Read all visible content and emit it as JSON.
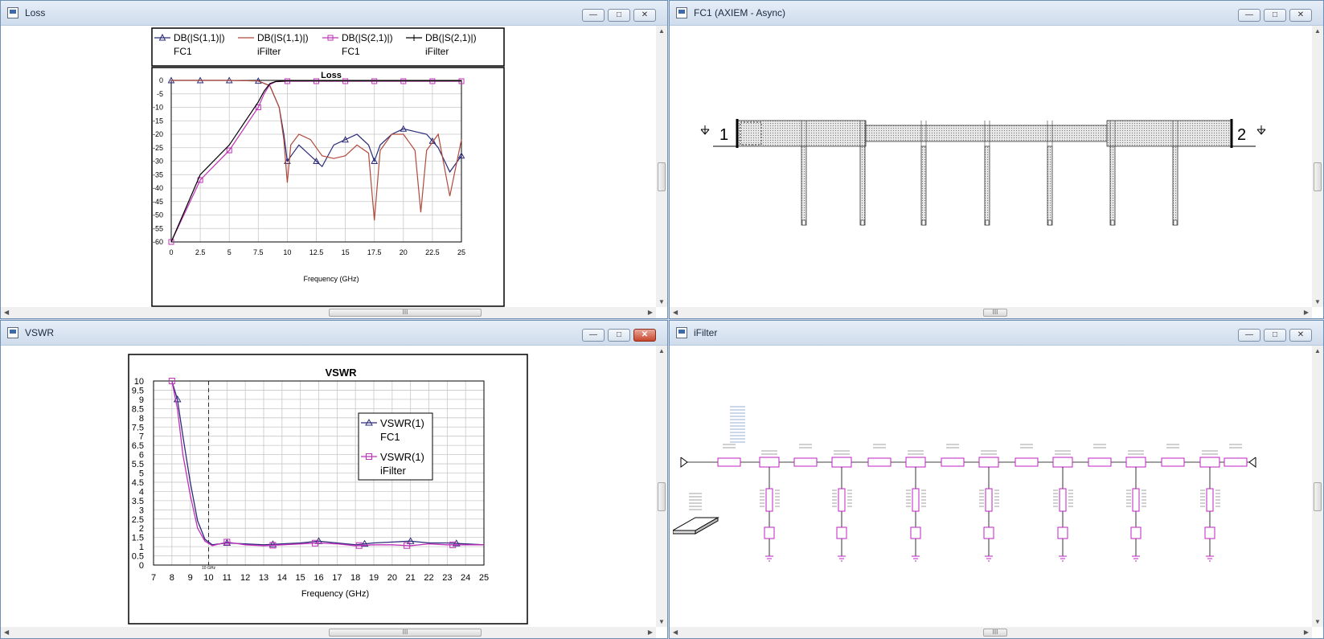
{
  "windows": {
    "loss": {
      "title": "Loss"
    },
    "fc1": {
      "title": "FC1 (AXIEM - Async)"
    },
    "vswr": {
      "title": "VSWR"
    },
    "ifilter": {
      "title": "iFilter"
    }
  },
  "scroll_thumb_label": "III",
  "fc1_layout": {
    "port1": "1",
    "port2": "2"
  },
  "colors": {
    "fc1_trace": "#2b2b7a",
    "ifilter_s11": "#b04a3a",
    "ifilter_s21": "#c030b8",
    "black": "#000000"
  },
  "chart_data": [
    {
      "type": "line",
      "title": "Loss",
      "xlabel": "Frequency (GHz)",
      "ylabel": "",
      "xlim": [
        0,
        25
      ],
      "ylim": [
        -60,
        0
      ],
      "xticks": [
        "0",
        "2.5",
        "5",
        "7.5",
        "10",
        "12.5",
        "15",
        "17.5",
        "20",
        "22.5",
        "25"
      ],
      "yticks": [
        "0",
        "-5",
        "-10",
        "-15",
        "-20",
        "-25",
        "-30",
        "-35",
        "-40",
        "-45",
        "-50",
        "-55",
        "-60"
      ],
      "grid": true,
      "legend": [
        {
          "line1": "DB(|S(1,1)|)",
          "line2": "FC1"
        },
        {
          "line1": "DB(|S(1,1)|)",
          "line2": "iFilter"
        },
        {
          "line1": "DB(|S(2,1)|)",
          "line2": "FC1"
        },
        {
          "line1": "DB(|S(2,1)|)",
          "line2": "iFilter"
        }
      ],
      "series": [
        {
          "x": [
            0,
            2.5,
            5,
            7.5,
            8.5,
            9.3,
            9.7,
            10,
            10.5,
            11,
            12,
            13,
            14,
            15,
            16,
            17,
            17.5,
            18,
            19,
            20,
            21,
            22,
            23,
            24,
            25
          ],
          "values": [
            0,
            0,
            0,
            -0.2,
            -2,
            -10,
            -20,
            -30,
            -27,
            -24,
            -28,
            -32,
            -24,
            -22,
            -20,
            -24,
            -30,
            -24,
            -20,
            -18,
            -19,
            -20,
            -25,
            -34,
            -28
          ]
        },
        {
          "x": [
            0,
            2.5,
            5,
            7.5,
            8.5,
            9.3,
            9.7,
            10,
            10.3,
            11,
            12,
            13,
            14,
            15,
            16,
            17,
            17.5,
            18,
            19,
            20,
            21,
            21.5,
            22,
            23,
            24,
            25
          ],
          "values": [
            0,
            0,
            0,
            -0.2,
            -2,
            -10,
            -22,
            -38,
            -24,
            -20,
            -22,
            -28,
            -29,
            -28,
            -24,
            -27,
            -52,
            -26,
            -20,
            -20,
            -26,
            -49,
            -26,
            -20,
            -43,
            -22
          ]
        },
        {
          "x": [
            0,
            2.5,
            5,
            7.5,
            8,
            8.5,
            9,
            10,
            12.5,
            15,
            17.5,
            20,
            22.5,
            25
          ],
          "values": [
            -60,
            -37,
            -26,
            -10,
            -5,
            -1.5,
            -0.5,
            -0.3,
            -0.3,
            -0.3,
            -0.3,
            -0.3,
            -0.3,
            -0.3
          ]
        },
        {
          "x": [
            0,
            2.5,
            5,
            7.5,
            8,
            8.5,
            9,
            10,
            12.5,
            15,
            17.5,
            20,
            22.5,
            25
          ],
          "values": [
            -60,
            -35,
            -24,
            -8,
            -4,
            -1.2,
            -0.4,
            -0.2,
            -0.2,
            -0.2,
            -0.2,
            -0.2,
            -0.2,
            -0.2
          ]
        }
      ]
    },
    {
      "type": "line",
      "title": "VSWR",
      "xlabel": "Frequency (GHz)",
      "ylabel": "",
      "xlim": [
        7,
        25
      ],
      "ylim": [
        0,
        10
      ],
      "xticks": [
        "7",
        "8",
        "9",
        "10",
        "11",
        "12",
        "13",
        "14",
        "15",
        "16",
        "17",
        "18",
        "19",
        "20",
        "21",
        "22",
        "23",
        "24",
        "25"
      ],
      "yticks": [
        "10",
        "9.5",
        "9",
        "8.5",
        "8",
        "7.5",
        "7",
        "6.5",
        "6",
        "5.5",
        "5",
        "4.5",
        "4",
        "3.5",
        "3",
        "2.5",
        "2",
        "1.5",
        "1",
        "0.5",
        "0"
      ],
      "grid": true,
      "marker_label": "10 GHz",
      "marker_x": 10,
      "legend": [
        {
          "line1": "VSWR(1)",
          "line2": "FC1"
        },
        {
          "line1": "VSWR(1)",
          "line2": "iFilter"
        }
      ],
      "series": [
        {
          "x": [
            8,
            8.3,
            8.6,
            9,
            9.4,
            9.8,
            10.2,
            11,
            12,
            13,
            14,
            15,
            16,
            17,
            18,
            19,
            20,
            21,
            22,
            23,
            24,
            25
          ],
          "values": [
            10,
            9,
            7,
            4.5,
            2.4,
            1.4,
            1.1,
            1.2,
            1.15,
            1.1,
            1.15,
            1.2,
            1.3,
            1.2,
            1.1,
            1.2,
            1.25,
            1.3,
            1.2,
            1.2,
            1.15,
            1.1
          ]
        },
        {
          "x": [
            8,
            8.3,
            8.6,
            9,
            9.4,
            9.8,
            10.2,
            11,
            12,
            13,
            14,
            15,
            16,
            17,
            18,
            19,
            20,
            21,
            22,
            23,
            24,
            25
          ],
          "values": [
            10,
            8.5,
            6,
            3.8,
            2,
            1.3,
            1.05,
            1.25,
            1.1,
            1.05,
            1.1,
            1.15,
            1.2,
            1.15,
            1.05,
            1.1,
            1.1,
            1.05,
            1.15,
            1.1,
            1.1,
            1.1
          ]
        }
      ]
    }
  ]
}
